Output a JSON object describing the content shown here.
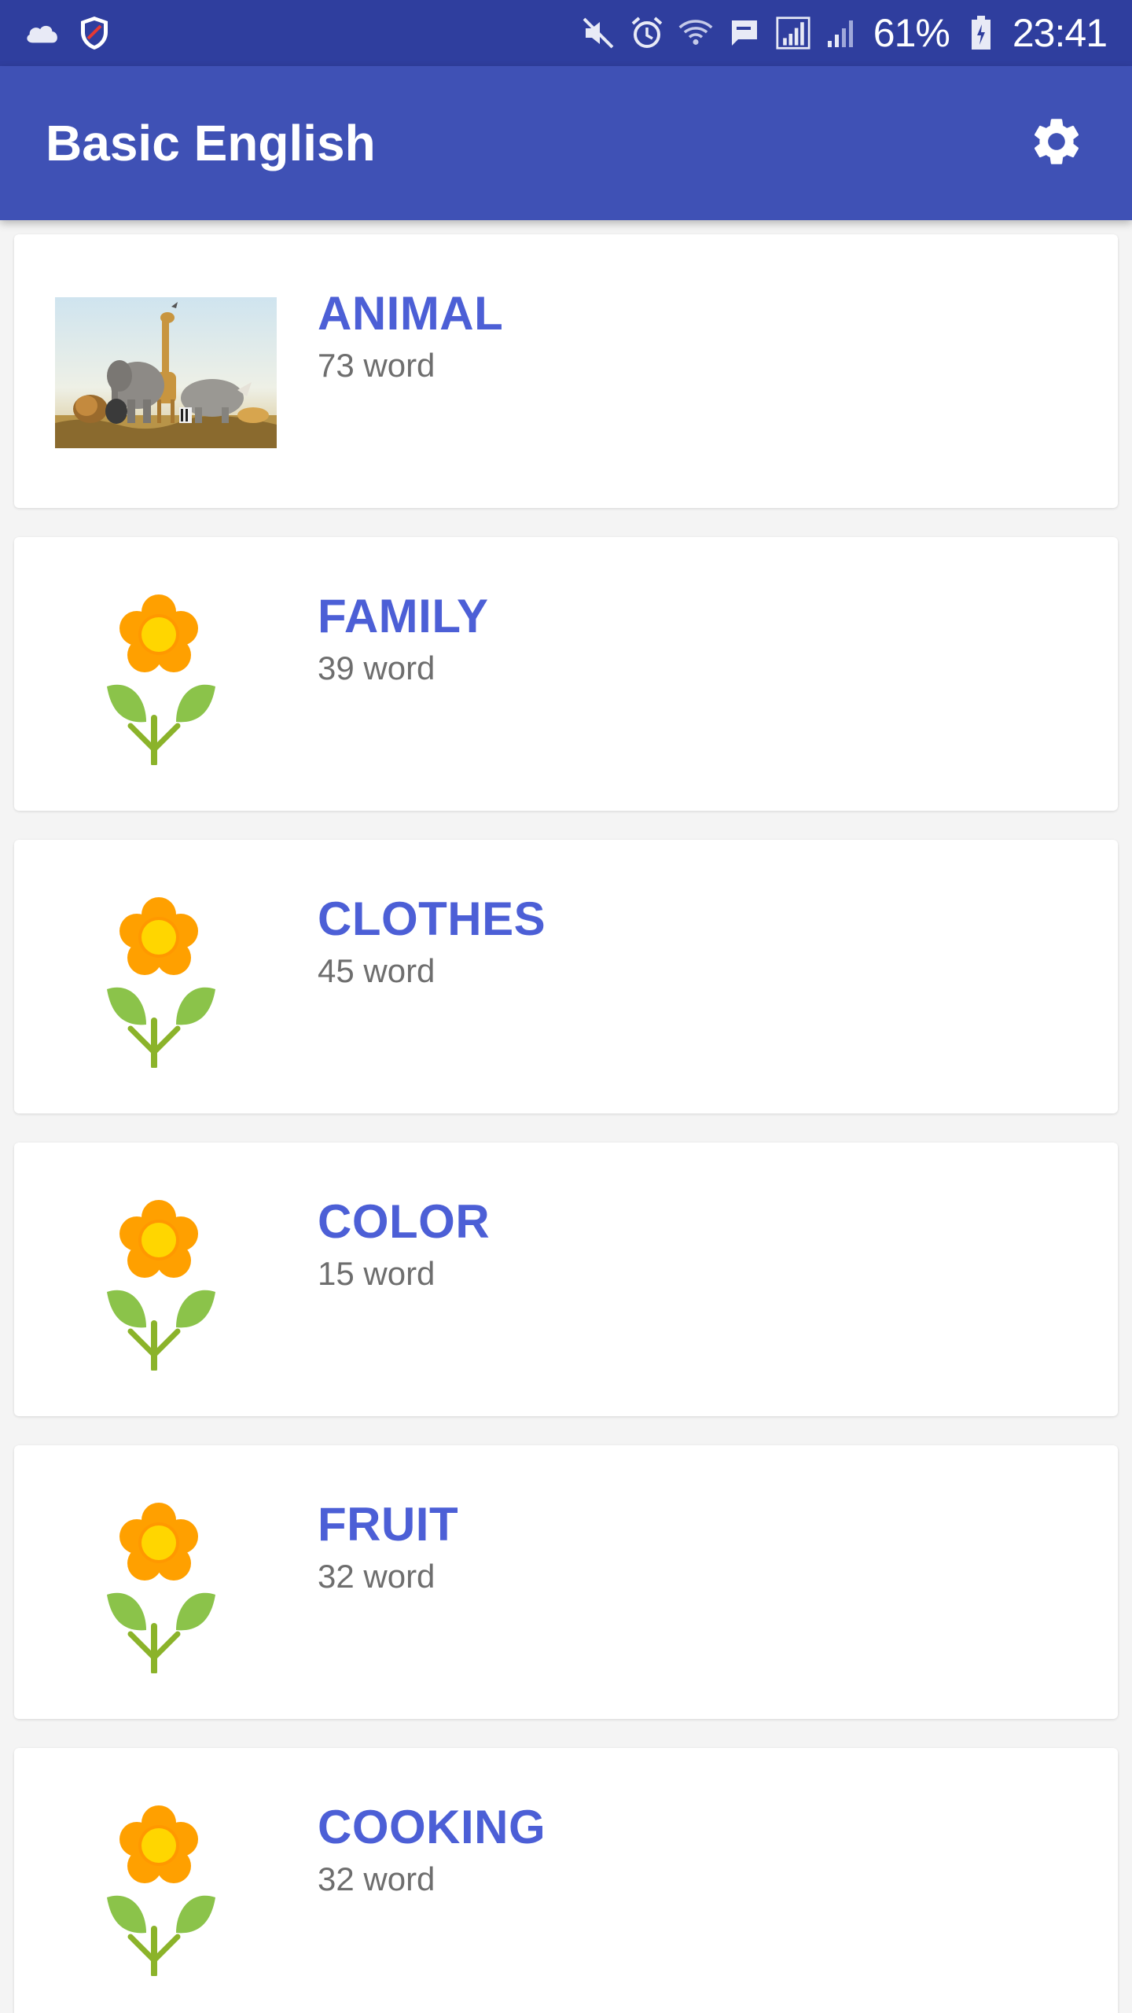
{
  "status_bar": {
    "battery": "61%",
    "time": "23:41",
    "icons": [
      "cloud-icon",
      "shield-icon",
      "mute-icon",
      "alarm-icon",
      "wifi-icon",
      "message-icon",
      "signal-icon",
      "signal-icon-2",
      "battery-icon"
    ]
  },
  "app_bar": {
    "title": "Basic English",
    "settings_icon": "gear-icon"
  },
  "categories": [
    {
      "title": "ANIMAL",
      "count": "73 word",
      "image": "animals-photo"
    },
    {
      "title": "FAMILY",
      "count": "39 word",
      "image": "flower-icon"
    },
    {
      "title": "CLOTHES",
      "count": "45 word",
      "image": "flower-icon"
    },
    {
      "title": "COLOR",
      "count": "15 word",
      "image": "flower-icon"
    },
    {
      "title": "FRUIT",
      "count": "32 word",
      "image": "flower-icon"
    },
    {
      "title": "COOKING",
      "count": "32 word",
      "image": "flower-icon"
    }
  ],
  "colors": {
    "status_bar": "#2f3e9e",
    "app_bar": "#3f51b5",
    "title_text": "#4c5fd6",
    "count_text": "#6e6e6e",
    "flower_petal": "#ffa000",
    "flower_center": "#ffd600",
    "leaf": "#8bc34a"
  }
}
